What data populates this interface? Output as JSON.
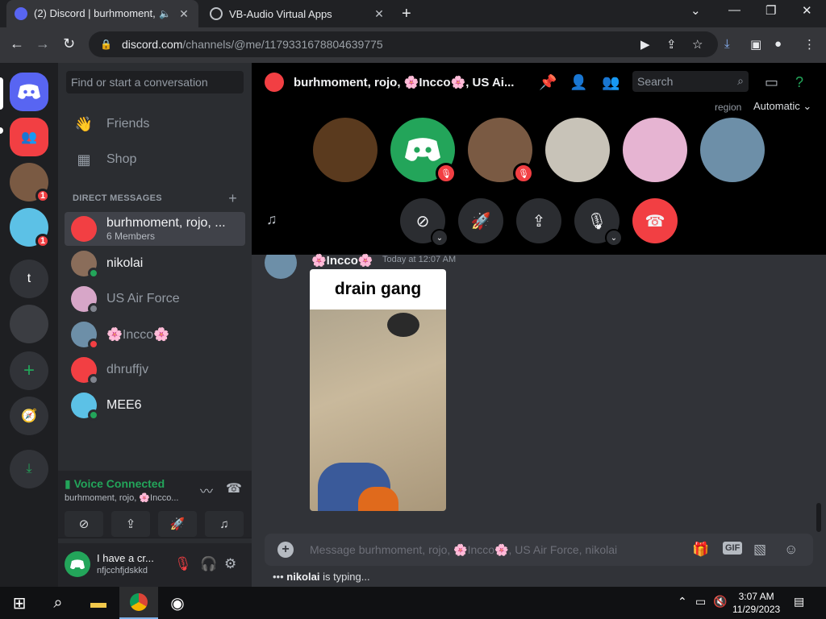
{
  "browser": {
    "tabs": [
      {
        "title": "(2) Discord | burhmoment, rojo, 🌸Incco🌸, US Air Force, nikolai",
        "active": true
      },
      {
        "title": "VB-Audio Virtual Apps",
        "active": false
      }
    ],
    "url_domain": "discord.com",
    "url_path": "/channels/@me/1179331678804639775"
  },
  "servers": {
    "badges": [
      "1",
      "1"
    ],
    "letter_server": "t"
  },
  "dm_sidebar": {
    "search_placeholder": "Find or start a conversation",
    "nav": [
      {
        "label": "Friends"
      },
      {
        "label": "Shop"
      }
    ],
    "section_label": "DIRECT MESSAGES",
    "dms": [
      {
        "name": "burhmoment, rojo, ...",
        "sub": "6 Members",
        "status": "",
        "color": "#f23f43"
      },
      {
        "name": "nikolai",
        "status": "online",
        "color": "#8a6d5a"
      },
      {
        "name": "US Air Force",
        "status": "offline",
        "color": "#d7a6c8"
      },
      {
        "name": "🌸Incco🌸",
        "status": "dnd",
        "color": "#6d8fa8"
      },
      {
        "name": "dhruffjv",
        "status": "offline",
        "color": "#f23f43"
      },
      {
        "name": "MEE6",
        "status": "online",
        "color": "#5cc1e6"
      }
    ]
  },
  "voice": {
    "status": "Voice Connected",
    "channel": "burhmoment, rojo, 🌸Incco..."
  },
  "user": {
    "name": "I have a cr...",
    "tag": "nfjcchfjdskkd"
  },
  "channel": {
    "title": "burhmoment, rojo, 🌸Incco🌸, US Ai...",
    "search_placeholder": "Search",
    "region_label": "region",
    "region_value": "Automatic"
  },
  "message": {
    "author": "🌸Incco🌸",
    "timestamp": "Today at 12:07 AM",
    "media_caption": "drain gang"
  },
  "composer": {
    "placeholder": "Message burhmoment, rojo, 🌸Incco🌸, US Air Force, nikolai",
    "gif_label": "GIF"
  },
  "typing": {
    "user": "nikolai",
    "suffix": " is typing..."
  },
  "taskbar": {
    "time": "3:07 AM",
    "date": "11/29/2023"
  },
  "colors": {
    "discord_blurple": "#5865f2",
    "online": "#23a55a",
    "dnd": "#f23f43",
    "offline": "#80848e"
  }
}
